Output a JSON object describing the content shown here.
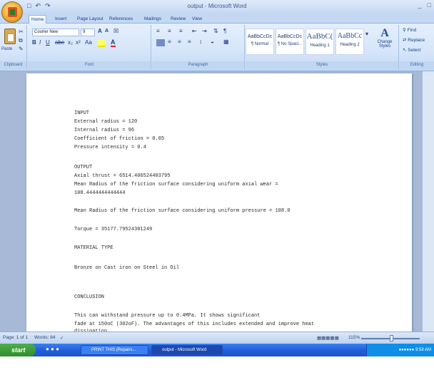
{
  "window": {
    "title": "output - Microsoft Word",
    "controls": [
      "_",
      "□"
    ]
  },
  "quick_access": {
    "save_icon": "save-icon",
    "undo": "↶",
    "redo": "↷"
  },
  "tabs": [
    "Home",
    "Insert",
    "Page Layout",
    "References",
    "Mailings",
    "Review",
    "View"
  ],
  "ribbon": {
    "clipboard": {
      "paste": "Paste",
      "label": "Clipboard"
    },
    "font": {
      "name": "Courier New",
      "size": "9",
      "label": "Font"
    },
    "paragraph": {
      "label": "Paragraph"
    },
    "styles": {
      "items": [
        {
          "sample": "AaBbCcDc",
          "name": "¶ Normal"
        },
        {
          "sample": "AaBbCcDc",
          "name": "¶ No Spaci..."
        },
        {
          "sample": "AaBbC(",
          "name": "Heading 1"
        },
        {
          "sample": "AaBbCc",
          "name": "Heading 2"
        }
      ],
      "change": "Change Styles",
      "label": "Styles"
    },
    "editing": {
      "find": "Find",
      "replace": "Replace",
      "select": "Select",
      "label": "Editing"
    }
  },
  "document": {
    "lines": [
      "INPUT",
      "External radius = 120",
      "Internal radius = 96",
      "Coefficient of friction = 0.05",
      "Pressure intensity = 0.4",
      "OUTPUT",
      "Axial thrust = 6514.406524403795",
      "Mean Radius of the friction surface considering uniform axial wear =",
      "108.4444444444444",
      "Mean Radius of the friction surface considering uniform pressure = 108.0",
      "Torque = 35177.79524301249",
      "MATERIAL TYPE",
      "Bronze on Cast iron on Steel in Oil",
      "CONCLUSION",
      "This can withstand pressure up to 0.4MPa. It shows significant",
      "fade at 150oC (302oF). The advantages of this includes extended and improve heat",
      "dissipation."
    ]
  },
  "status": {
    "page": "Page: 1 of 1",
    "words": "Words: 84",
    "zoom": "115%"
  },
  "taskbar": {
    "start": "start",
    "tasks": [
      "PRINT THIS (Repairs...",
      "output - Microsoft Word"
    ],
    "time": "9:58 AM"
  }
}
